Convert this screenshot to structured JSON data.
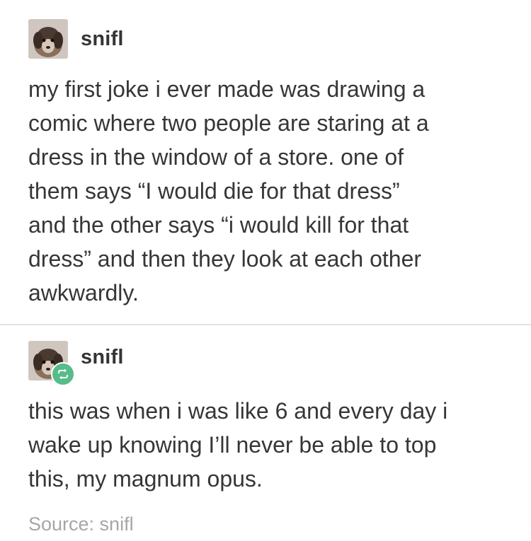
{
  "posts": [
    {
      "username": "snifl",
      "avatar_icon": "dog-avatar-icon",
      "text": "my first joke i ever made was drawing a\ncomic where two people are staring at a\ndress in the window of a store. one of\nthem says “I would die for that dress”\nand the other says “i would kill for that\ndress” and then they look at each other\nawkwardly."
    },
    {
      "username": "snifl",
      "avatar_icon": "dog-avatar-icon",
      "badge_icon": "reblog-icon",
      "text": "this was when i was like 6 and every day i\nwake up knowing I’ll never be able to top\nthis, my magnum opus."
    }
  ],
  "source": "Source: snifl",
  "colors": {
    "text": "#363636",
    "source_text": "#a6a6a6",
    "reblog_badge": "#56bc8a",
    "divider": "#e4e4e4"
  }
}
